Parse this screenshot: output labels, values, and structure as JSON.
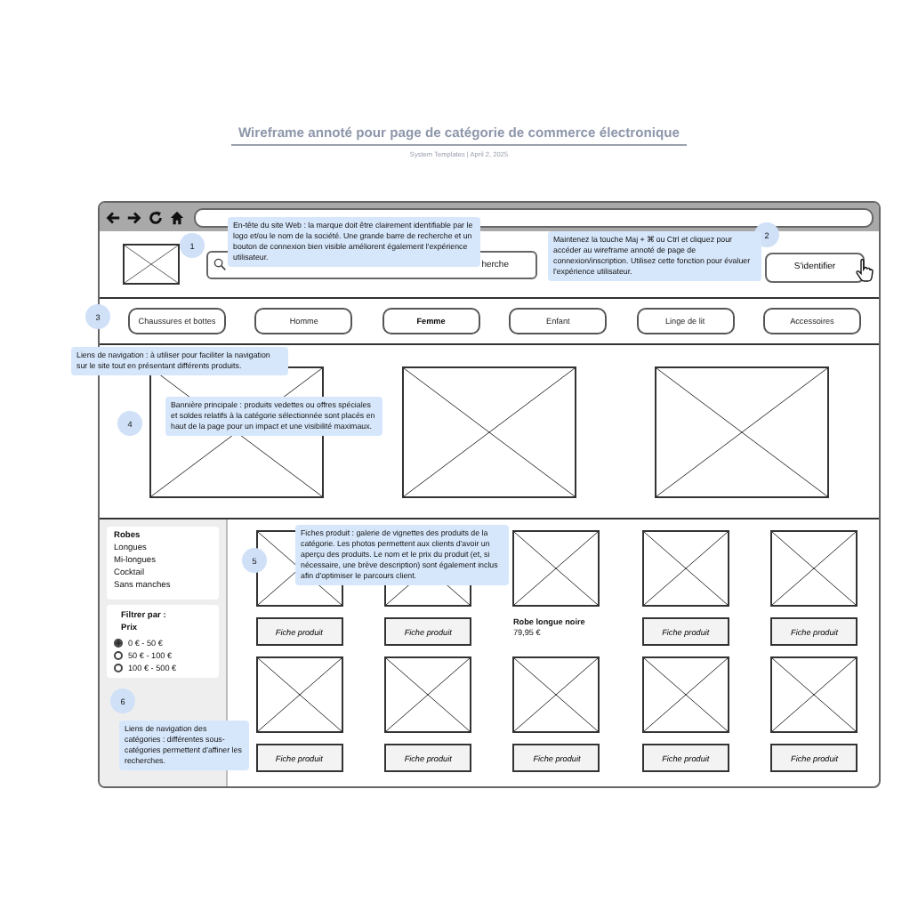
{
  "title": "Wireframe annoté pour page de catégorie de commerce électronique",
  "subtitle": "System Templates  |  April 2, 2025",
  "header": {
    "search": {
      "value": "herche"
    },
    "signin_button": "S'identifier"
  },
  "nav": [
    {
      "label": "Chaussures et bottes",
      "selected": false
    },
    {
      "label": "Homme",
      "selected": false
    },
    {
      "label": "Femme",
      "selected": true
    },
    {
      "label": "Enfant",
      "selected": false
    },
    {
      "label": "Linge de lit",
      "selected": false
    },
    {
      "label": "Accessoires",
      "selected": false
    }
  ],
  "sidebar": {
    "category": "Robes",
    "subcategories": [
      "Longues",
      "Mi-longues",
      "Cocktail",
      "Sans manches"
    ],
    "filter_title": "Filtrer par :",
    "filter_group": "Prix",
    "price_options": [
      {
        "label": "0 € - 50 €",
        "selected": true
      },
      {
        "label": "50 € - 100 €",
        "selected": false
      },
      {
        "label": "100 € - 500 €",
        "selected": false
      }
    ]
  },
  "products": [
    {
      "kind": "button",
      "label": "Fiche produit"
    },
    {
      "kind": "button",
      "label": "Fiche produit"
    },
    {
      "kind": "detail",
      "name": "Robe longue noire",
      "price": "79,95 €"
    },
    {
      "kind": "button",
      "label": "Fiche produit"
    },
    {
      "kind": "button",
      "label": "Fiche produit"
    },
    {
      "kind": "button",
      "label": "Fiche produit"
    },
    {
      "kind": "button",
      "label": "Fiche produit"
    },
    {
      "kind": "button",
      "label": "Fiche produit"
    },
    {
      "kind": "button",
      "label": "Fiche produit"
    },
    {
      "kind": "button",
      "label": "Fiche produit"
    }
  ],
  "callouts": [
    {
      "number": "1",
      "text": "En-tête du site Web : la marque doit être clairement identifiable par le logo et/ou le nom de la société. Une grande barre de recherche et un bouton de connexion bien visible améliorent également l'expérience utilisateur."
    },
    {
      "number": "2",
      "text": "Maintenez la touche Maj + ⌘ ou Ctrl et cliquez pour accéder au wireframe annoté de page de connexion/inscription. Utilisez cette fonction pour évaluer l'expérience utilisateur."
    },
    {
      "number": "3",
      "text": "Liens de navigation : à utiliser pour faciliter la navigation sur le site tout en présentant différents produits."
    },
    {
      "number": "4",
      "text": "Bannière principale : produits vedettes ou offres spéciales et soldes relatifs à la catégorie sélectionnée sont placés en haut de la page pour un impact et une visibilité maximaux."
    },
    {
      "number": "5",
      "text": "Fiches produit : galerie de vignettes des produits de la catégorie. Les photos permettent aux clients d'avoir un aperçu des produits. Le nom et le prix du produit (et, si nécessaire, une brève description) sont également inclus afin d'optimiser le parcours client."
    },
    {
      "number": "6",
      "text": "Liens de navigation des catégories : différentes sous-catégories permettent d'affiner les recherches."
    }
  ]
}
